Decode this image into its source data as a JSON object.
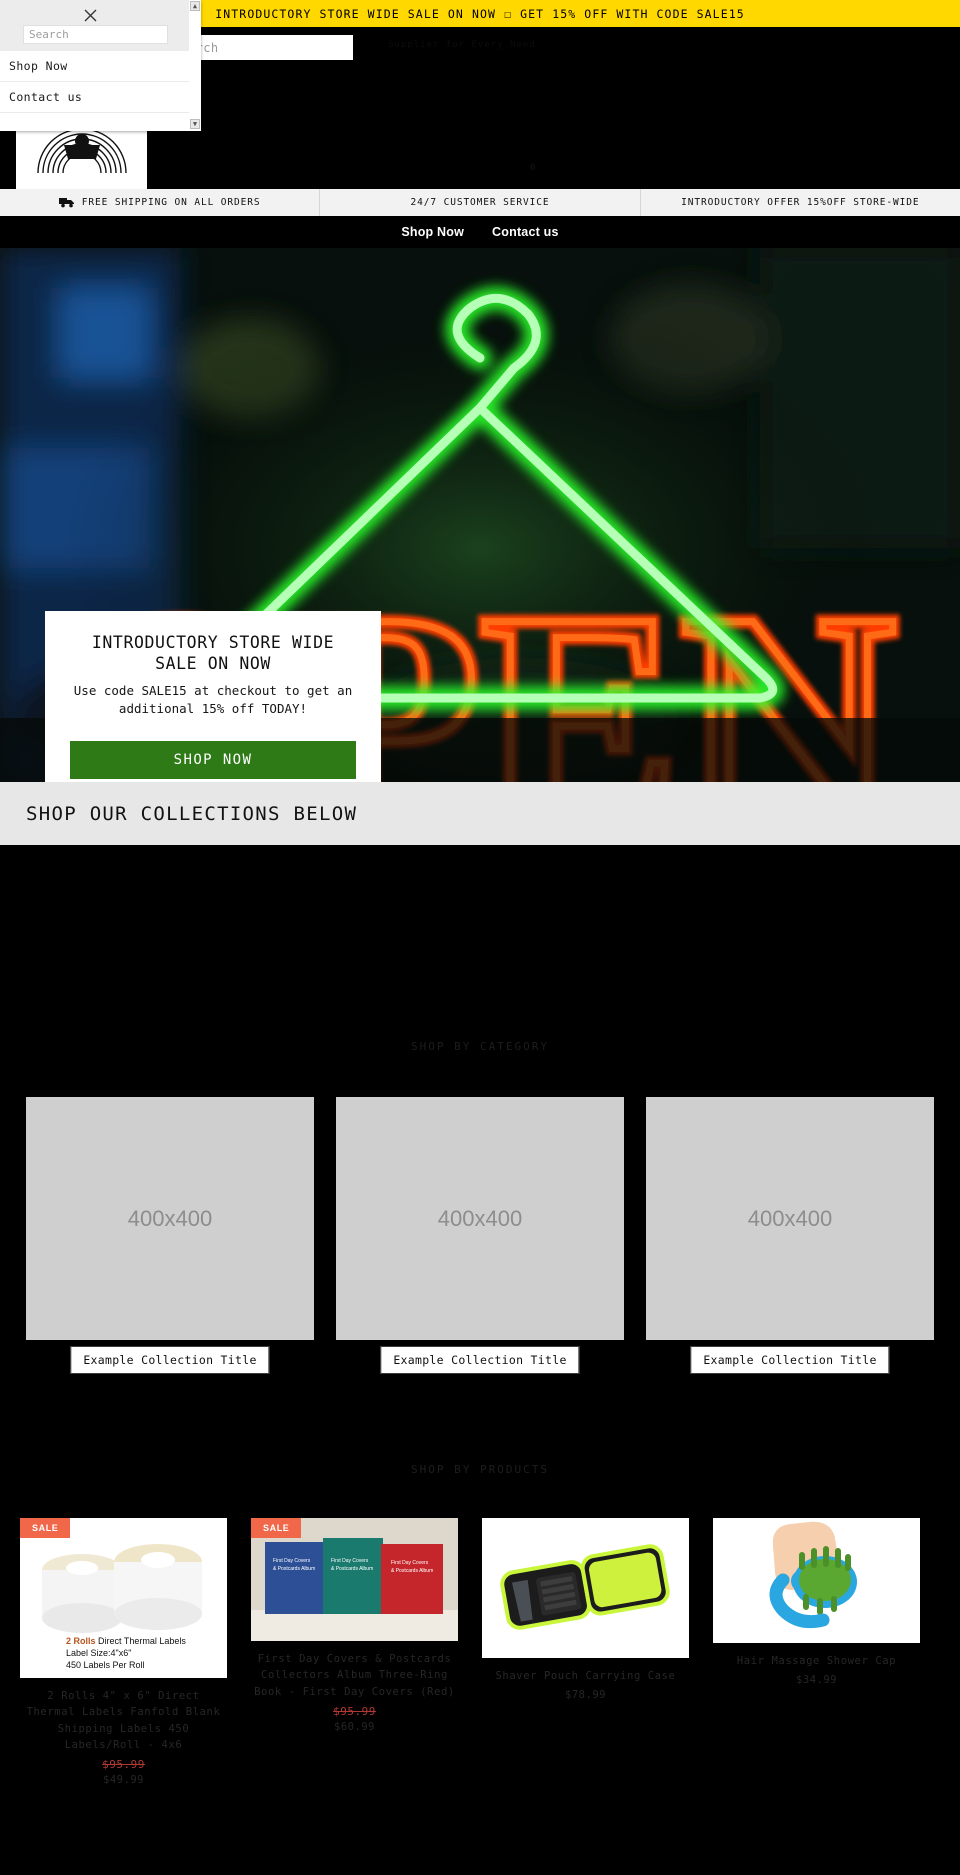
{
  "announcement": {
    "text": "INTRODUCTORY STORE WIDE SALE ON NOW ☐ GET 15% OFF WITH CODE SALE15",
    "bg": "#FFD800"
  },
  "header": {
    "search_placeholder": "Search",
    "search_visible_text": "arch",
    "tagline": "Supplier for Every Need",
    "cart_label": "0",
    "logo_alt": "store-logo"
  },
  "trustbar": {
    "items": [
      {
        "icon": "truck-icon",
        "label": "FREE SHIPPING ON ALL ORDERS"
      },
      {
        "icon": "",
        "label": "24/7 CUSTOMER SERVICE"
      },
      {
        "icon": "",
        "label": "INTRODUCTORY OFFER 15%OFF STORE-WIDE"
      }
    ]
  },
  "mainnav": {
    "items": [
      {
        "label": "Shop Now"
      },
      {
        "label": "Contact us"
      }
    ]
  },
  "hero": {
    "title": "INTRODUCTORY STORE WIDE SALE ON NOW",
    "subtitle": "Use code SALE15 at checkout to get an additional 15% off TODAY!",
    "button_label": "SHOP NOW",
    "button_color": "#2d7a16",
    "image_alt": "neon-open-sign-hanger"
  },
  "collections": {
    "heading": "SHOP OUR COLLECTIONS BELOW",
    "subheading": "SHOP BY CATEGORY",
    "cards": [
      {
        "image_label": "400x400",
        "title": "Example Collection Title"
      },
      {
        "image_label": "400x400",
        "title": "Example Collection Title"
      },
      {
        "image_label": "400x400",
        "title": "Example Collection Title"
      }
    ]
  },
  "products": {
    "subheading": "SHOP BY PRODUCTS",
    "items": [
      {
        "badge": "SALE",
        "title": "2 Rolls 4\" x 6\" Direct Thermal Labels Fanfold Blank Shipping Labels 450 Labels/Roll - 4x6",
        "price_old": "$95.99",
        "price": "$49.99",
        "image_alt": "thermal-label-rolls"
      },
      {
        "badge": "SALE",
        "title": "First Day Covers & Postcards Collectors Album Three-Ring Book - First Day Covers (Red)",
        "price_old": "$95.99",
        "price": "$60.99",
        "image_alt": "postcard-albums"
      },
      {
        "badge": "",
        "title": "Shaver Pouch Carrying Case",
        "price_old": "",
        "price": "$78.99",
        "image_alt": "shaver-pouch-case"
      },
      {
        "badge": "",
        "title": "Hair Massage Shower Cap",
        "price_old": "",
        "price": "$34.99",
        "image_alt": "hair-scalp-massager"
      }
    ]
  },
  "drawer": {
    "search_placeholder": "Search",
    "search_value": "",
    "close_label": "×",
    "links": [
      {
        "label": "Shop Now"
      },
      {
        "label": "Contact us"
      }
    ]
  }
}
